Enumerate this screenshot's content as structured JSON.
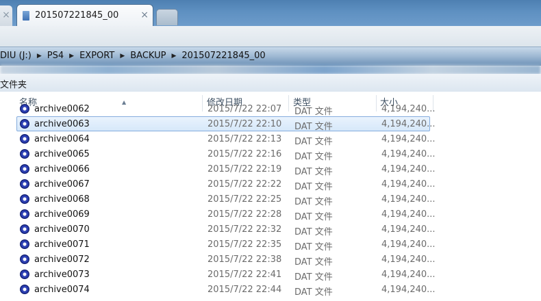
{
  "tabs": {
    "active_title": "201507221845_00",
    "prev_close": "×",
    "active_close": "×"
  },
  "breadcrumb": [
    "DIU (J:)",
    "PS4",
    "EXPORT",
    "BACKUP",
    "201507221845_00"
  ],
  "breadcrumb_sep": "▶",
  "folder_header": "文件夹",
  "columns": {
    "name": "名称",
    "date": "修改日期",
    "type": "类型",
    "size": "大小",
    "sort_indicator": "▲"
  },
  "files": [
    {
      "name": "archive0062",
      "date": "2015/7/22 22:07",
      "type": "DAT 文件",
      "size": "4,194,240..."
    },
    {
      "name": "archive0063",
      "date": "2015/7/22 22:10",
      "type": "DAT 文件",
      "size": "4,194,240...",
      "selected": true
    },
    {
      "name": "archive0064",
      "date": "2015/7/22 22:13",
      "type": "DAT 文件",
      "size": "4,194,240..."
    },
    {
      "name": "archive0065",
      "date": "2015/7/22 22:16",
      "type": "DAT 文件",
      "size": "4,194,240..."
    },
    {
      "name": "archive0066",
      "date": "2015/7/22 22:19",
      "type": "DAT 文件",
      "size": "4,194,240..."
    },
    {
      "name": "archive0067",
      "date": "2015/7/22 22:22",
      "type": "DAT 文件",
      "size": "4,194,240..."
    },
    {
      "name": "archive0068",
      "date": "2015/7/22 22:25",
      "type": "DAT 文件",
      "size": "4,194,240..."
    },
    {
      "name": "archive0069",
      "date": "2015/7/22 22:28",
      "type": "DAT 文件",
      "size": "4,194,240..."
    },
    {
      "name": "archive0070",
      "date": "2015/7/22 22:32",
      "type": "DAT 文件",
      "size": "4,194,240..."
    },
    {
      "name": "archive0071",
      "date": "2015/7/22 22:35",
      "type": "DAT 文件",
      "size": "4,194,240..."
    },
    {
      "name": "archive0072",
      "date": "2015/7/22 22:38",
      "type": "DAT 文件",
      "size": "4,194,240..."
    },
    {
      "name": "archive0073",
      "date": "2015/7/22 22:41",
      "type": "DAT 文件",
      "size": "4,194,240..."
    },
    {
      "name": "archive0074",
      "date": "2015/7/22 22:44",
      "type": "DAT 文件",
      "size": "4,194,240..."
    }
  ],
  "icons": {
    "file": "ps-disc-icon",
    "tab_file": "folder-file-icon"
  }
}
